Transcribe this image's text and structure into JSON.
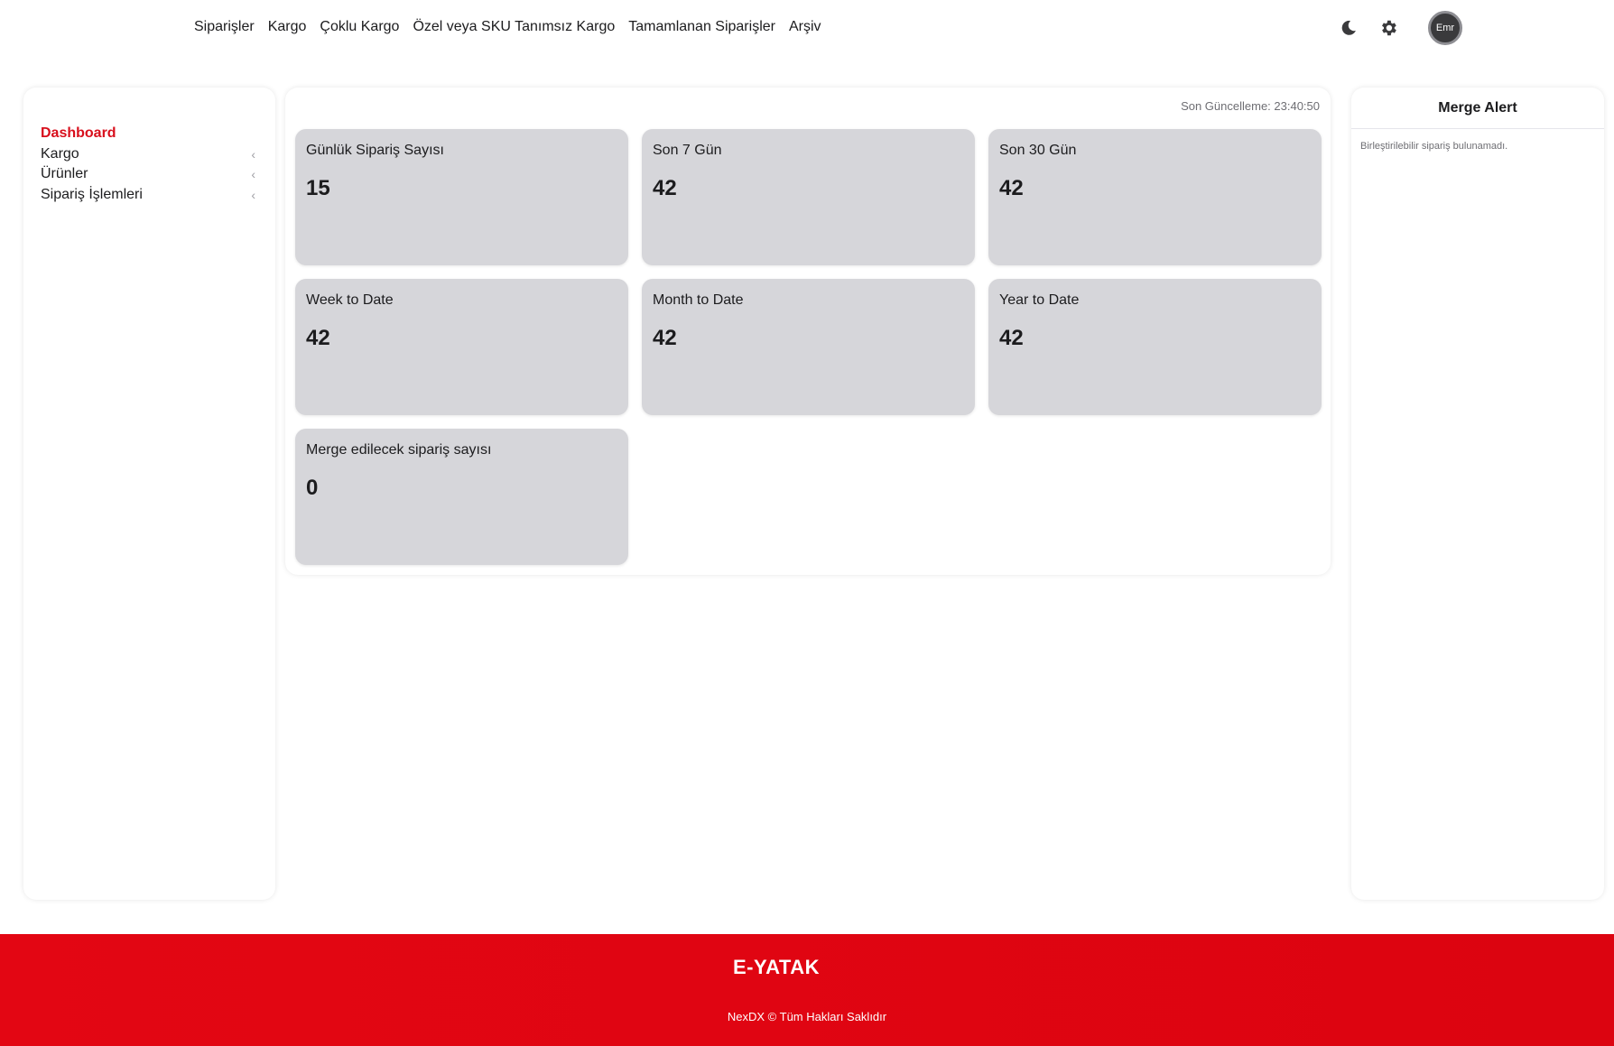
{
  "topnav": {
    "links": [
      "Siparişler",
      "Kargo",
      "Çoklu Kargo",
      "Özel veya SKU Tanımsız Kargo",
      "Tamamlanan Siparişler",
      "Arşiv"
    ],
    "avatar_text": "Emr",
    "icons": [
      "moon-icon",
      "gear-icon"
    ]
  },
  "sidebar": {
    "items": [
      {
        "label": "Dashboard",
        "active": true
      },
      {
        "label": "Kargo",
        "has_children": true
      },
      {
        "label": "Ürünler",
        "has_children": true
      },
      {
        "label": "Sipariş İşlemleri",
        "has_children": true
      }
    ],
    "chevron": "‹"
  },
  "main": {
    "last_update": "Son Güncelleme: 23:40:50",
    "cards": [
      {
        "title": "Günlük Sipariş Sayısı",
        "value": "15"
      },
      {
        "title": "Son 7 Gün",
        "value": "42"
      },
      {
        "title": "Son 30 Gün",
        "value": "42"
      },
      {
        "title": "Week to Date",
        "value": "42"
      },
      {
        "title": "Month to Date",
        "value": "42"
      },
      {
        "title": "Year to Date",
        "value": "42"
      },
      {
        "title": "Merge edilecek sipariş sayısı",
        "value": "0"
      }
    ]
  },
  "right_panel": {
    "title": "Merge Alert",
    "message": "Birleştirilebilir sipariş bulunamadı."
  },
  "footer": {
    "brand": "E-YATAK",
    "copyright": "NexDX © Tüm Hakları Saklıdır"
  },
  "colors": {
    "accent": "#d80f1c",
    "card_bg": "#d6d6da",
    "footer_bg": "#e30613"
  }
}
